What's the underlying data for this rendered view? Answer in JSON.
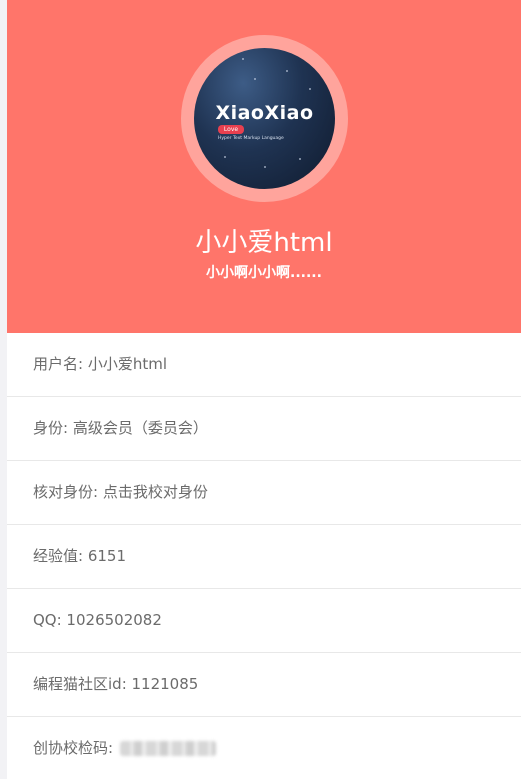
{
  "profile": {
    "avatar_logo_text": "XiaoXiao",
    "avatar_badge_text": "Love",
    "avatar_subtitle": "Hyper Text Markup Language",
    "display_name": "小小爱html",
    "signature": "小小啊小小啊......"
  },
  "info": {
    "username": "用户名: 小小爱html",
    "identity": "身份: 高级会员（委员会）",
    "verify": "核对身份: 点击我校对身份",
    "experience": "经验值:  6151",
    "qq": "QQ: 1026502082",
    "community_id": "编程猫社区id: 1121085",
    "verify_code_label": "创协校检码: "
  },
  "colors": {
    "header_bg": "#ff756a",
    "avatar_ring": "#ffa49c",
    "row_text": "#6b6b6b"
  }
}
